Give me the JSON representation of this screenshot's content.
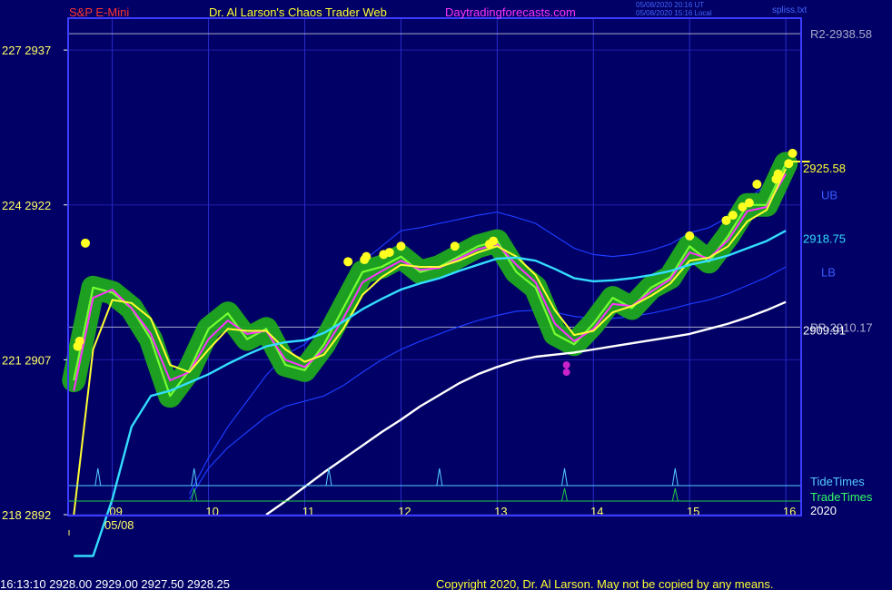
{
  "header": {
    "symbol": "S&P E-Mini",
    "site_title": "Dr. Al Larson's Chaos Trader Web",
    "site_url": "Daytradingforecasts.com",
    "timestamp_utc": "05/08/2020 20:16 UT",
    "timestamp_local": "05/08/2020 15:16 Local",
    "file": "spliss.txt"
  },
  "footer": {
    "quote": "16:13:10  2928.00  2929.00  2927.50  2928.25",
    "copyright": "Copyright 2020, Dr. Al Larson. May not be copied by any means."
  },
  "colors": {
    "background": "#000066",
    "frame": "#3c3cff",
    "price_label": "#ffff66",
    "green_band": "#1fa81f",
    "price": "#77ff33",
    "magenta_ma": "#ff33ff",
    "yellow_ma": "#ffff33",
    "cyan_ma": "#33ddff",
    "white_ma": "#ffffff",
    "blue_band": "#1c3cff",
    "tide": "#55ccff",
    "trade": "#22cc44"
  },
  "chart_data": {
    "type": "line",
    "ylim": [
      2892,
      2940
    ],
    "y_ticks": [
      {
        "price": 2937,
        "label": "227  2937"
      },
      {
        "price": 2922,
        "label": "224  2922"
      },
      {
        "price": 2907,
        "label": "221  2907"
      },
      {
        "price": 2892,
        "label": "218  2892"
      }
    ],
    "x_ticks": [
      "09",
      "10",
      "11",
      "12",
      "13",
      "14",
      "15",
      "16"
    ],
    "x_date_label": "05/08",
    "year_label": "2020",
    "levels": [
      {
        "label": "R2-2938.58",
        "value": 2938.58
      },
      {
        "label": "PP-2910.17",
        "value": 2910.17
      }
    ],
    "value_labels": [
      {
        "label": "2925.58",
        "value": 2925.58
      },
      {
        "label": "2918.75",
        "value": 2918.75
      },
      {
        "label": "2909.91",
        "value": 2909.91
      }
    ],
    "band_labels": [
      {
        "label": "UB",
        "value": 2923.0
      },
      {
        "label": "LB",
        "value": 2915.5
      }
    ],
    "hours": [
      8.6,
      8.8,
      9.0,
      9.2,
      9.4,
      9.6,
      9.8,
      10.0,
      10.2,
      10.4,
      10.6,
      10.8,
      11.0,
      11.2,
      11.4,
      11.6,
      11.8,
      12.0,
      12.2,
      12.4,
      12.6,
      12.8,
      13.0,
      13.2,
      13.4,
      13.6,
      13.8,
      14.0,
      14.2,
      14.4,
      14.6,
      14.8,
      15.0,
      15.2,
      15.4,
      15.6,
      15.8,
      16.0
    ],
    "series": [
      {
        "role": "price",
        "values": [
          2905.0,
          2914.0,
          2913.5,
          2912.0,
          2909.0,
          2903.5,
          2906.0,
          2910.0,
          2911.5,
          2909.0,
          2910.0,
          2906.5,
          2906.0,
          2908.5,
          2912.0,
          2915.5,
          2916.0,
          2917.0,
          2915.5,
          2916.0,
          2917.0,
          2918.0,
          2918.5,
          2915.5,
          2914.0,
          2909.5,
          2908.5,
          2910.5,
          2913.0,
          2912.0,
          2914.0,
          2915.0,
          2918.0,
          2916.5,
          2919.0,
          2922.0,
          2922.0,
          2926.0
        ]
      },
      {
        "role": "ma1",
        "values": [
          2904.0,
          2913.0,
          2913.8,
          2912.0,
          2909.5,
          2905.0,
          2905.8,
          2909.0,
          2910.8,
          2909.5,
          2909.8,
          2907.0,
          2906.3,
          2908.0,
          2911.0,
          2914.5,
          2915.6,
          2916.6,
          2915.7,
          2915.9,
          2916.8,
          2917.7,
          2918.2,
          2916.2,
          2914.5,
          2910.5,
          2908.8,
          2910.0,
          2912.4,
          2912.2,
          2913.6,
          2914.8,
          2917.4,
          2916.8,
          2918.6,
          2921.4,
          2921.8,
          2925.0
        ]
      },
      {
        "role": "ma2",
        "values": [
          2892.0,
          2908.0,
          2912.8,
          2912.5,
          2911.0,
          2906.5,
          2905.8,
          2908.0,
          2910.0,
          2909.8,
          2909.8,
          2908.0,
          2906.8,
          2907.5,
          2910.0,
          2913.3,
          2915.0,
          2916.2,
          2916.0,
          2916.0,
          2916.6,
          2917.4,
          2918.0,
          2917.0,
          2915.2,
          2911.8,
          2909.4,
          2909.8,
          2911.6,
          2912.2,
          2913.2,
          2914.4,
          2916.6,
          2916.9,
          2918.0,
          2920.4,
          2921.5,
          2925.5
        ]
      },
      {
        "role": "ma3",
        "values": [
          2888.0,
          2888.0,
          2893.5,
          2900.5,
          2903.5,
          2904.0,
          2904.8,
          2905.6,
          2906.6,
          2907.5,
          2908.3,
          2908.7,
          2908.9,
          2909.6,
          2910.7,
          2911.9,
          2912.9,
          2913.8,
          2914.4,
          2914.9,
          2915.6,
          2916.2,
          2916.8,
          2916.9,
          2916.6,
          2915.8,
          2914.9,
          2914.6,
          2914.7,
          2914.9,
          2915.2,
          2915.6,
          2916.2,
          2916.6,
          2917.1,
          2917.8,
          2918.5,
          2919.5
        ]
      },
      {
        "role": "ma4",
        "values": [
          null,
          null,
          null,
          null,
          null,
          null,
          null,
          null,
          null,
          null,
          2892.0,
          2893.3,
          2894.7,
          2896.1,
          2897.4,
          2898.7,
          2900.0,
          2901.2,
          2902.5,
          2903.6,
          2904.7,
          2905.6,
          2906.3,
          2906.9,
          2907.3,
          2907.5,
          2907.7,
          2908.0,
          2908.3,
          2908.6,
          2908.9,
          2909.2,
          2909.5,
          2910.0,
          2910.5,
          2911.1,
          2911.8,
          2912.6
        ]
      },
      {
        "role": "upper_band",
        "values": [
          null,
          null,
          null,
          null,
          null,
          null,
          2894.0,
          2897.5,
          2900.5,
          2903.0,
          2905.5,
          2907.5,
          2908.5,
          2910.5,
          2913.5,
          2916.5,
          2918.0,
          2919.5,
          2919.8,
          2920.2,
          2920.6,
          2921.0,
          2921.3,
          2920.8,
          2920.2,
          2919.0,
          2917.8,
          2917.2,
          2917.0,
          2917.2,
          2917.6,
          2918.2,
          2919.3,
          2919.8,
          2920.8,
          2922.5,
          2924.0,
          2926.0
        ]
      },
      {
        "role": "lower_band",
        "values": [
          null,
          null,
          null,
          null,
          null,
          null,
          2893.5,
          2896.5,
          2898.5,
          2900.0,
          2901.5,
          2902.5,
          2903.0,
          2903.5,
          2904.5,
          2905.8,
          2907.0,
          2908.0,
          2908.8,
          2909.5,
          2910.2,
          2910.8,
          2911.3,
          2911.7,
          2911.8,
          2911.6,
          2911.2,
          2911.0,
          2911.0,
          2911.2,
          2911.5,
          2911.9,
          2912.4,
          2912.8,
          2913.4,
          2914.2,
          2915.0,
          2916.0
        ]
      }
    ],
    "signal_dots": [
      {
        "x": 8.72,
        "y": 2918.3
      },
      {
        "x": 8.64,
        "y": 2908.3
      },
      {
        "x": 8.66,
        "y": 2908.8
      },
      {
        "x": 11.45,
        "y": 2916.5
      },
      {
        "x": 11.62,
        "y": 2916.7
      },
      {
        "x": 11.64,
        "y": 2917.0
      },
      {
        "x": 11.82,
        "y": 2917.2
      },
      {
        "x": 11.88,
        "y": 2917.4
      },
      {
        "x": 12.0,
        "y": 2918.0
      },
      {
        "x": 12.56,
        "y": 2918.0
      },
      {
        "x": 12.92,
        "y": 2918.2
      },
      {
        "x": 12.96,
        "y": 2918.5
      },
      {
        "x": 15.0,
        "y": 2919.0
      },
      {
        "x": 15.38,
        "y": 2920.5
      },
      {
        "x": 15.45,
        "y": 2921.0
      },
      {
        "x": 15.55,
        "y": 2921.8
      },
      {
        "x": 15.62,
        "y": 2922.2
      },
      {
        "x": 15.7,
        "y": 2924.0
      },
      {
        "x": 15.9,
        "y": 2924.5
      },
      {
        "x": 15.92,
        "y": 2925.0
      },
      {
        "x": 16.03,
        "y": 2926.0
      },
      {
        "x": 16.07,
        "y": 2927.0
      }
    ],
    "low_dots": [
      {
        "x": 13.72,
        "y": 2906.5
      },
      {
        "x": 13.72,
        "y": 2905.8
      }
    ],
    "tide_times": [
      8.85,
      9.85,
      11.25,
      12.4,
      13.7,
      14.85
    ],
    "trade_times": [
      9.85,
      13.7,
      14.85
    ],
    "tide_label": "TideTimes",
    "trade_label": "TradeTimes"
  }
}
